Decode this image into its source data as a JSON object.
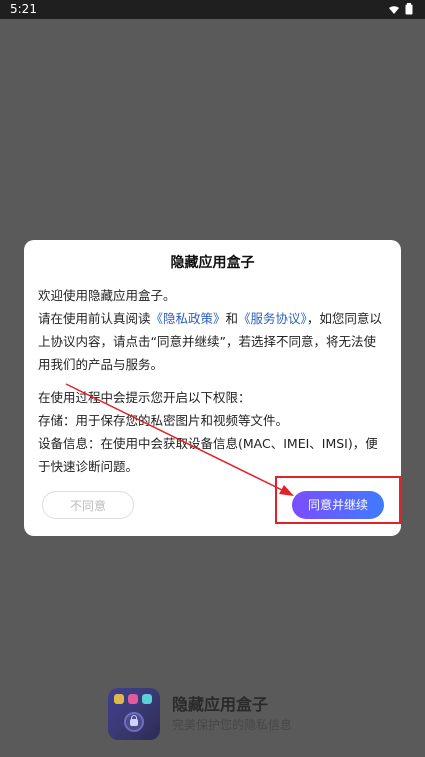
{
  "status_bar": {
    "time": "5:21"
  },
  "dialog": {
    "title": "隐藏应用盒子",
    "greeting": "欢迎使用隐藏应用盒子。",
    "consent_prefix": "请在使用前认真阅读",
    "privacy_link": "《隐私政策》",
    "and": "和",
    "service_link": "《服务协议》",
    "consent_suffix": "，如您同意以上协议内容，请点击“同意并继续”，若选择不同意，将无法使用我们的产品与服务。",
    "permissions_intro": "在使用过程中会提示您开启以下权限：",
    "permission_storage": "存储：用于保存您的私密图片和视频等文件。",
    "permission_device": "设备信息：在使用中会获取设备信息(MAC、IMEI、IMSI)，便于快速诊断问题。",
    "disagree_button": "不同意",
    "agree_button": "同意并继续"
  },
  "footer": {
    "app_name": "隐藏应用盒子",
    "slogan": "完美保护您的隐私信息"
  },
  "colors": {
    "link": "#2e5fba",
    "agree_gradient_start": "#7b4dff",
    "agree_gradient_end": "#3f7bff",
    "annotation_red": "#e0222a"
  },
  "icons": {
    "wifi": "wifi-icon",
    "battery": "battery-icon",
    "app_icon": "lock-app-icon"
  }
}
